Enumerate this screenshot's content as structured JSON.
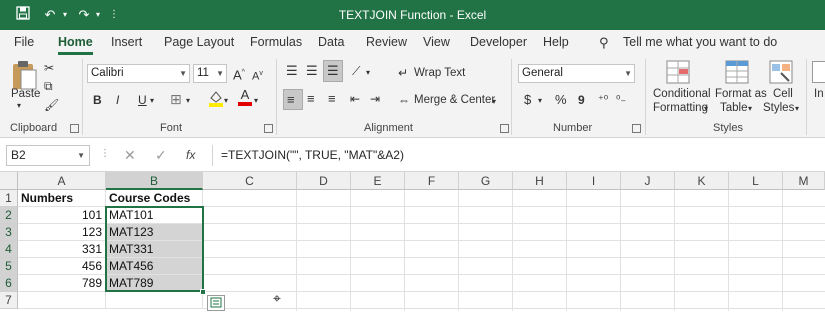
{
  "window": {
    "title": "TEXTJOIN Function  -  Excel"
  },
  "ribbon_tabs": [
    "File",
    "Home",
    "Insert",
    "Page Layout",
    "Formulas",
    "Data",
    "Review",
    "View",
    "Developer",
    "Help"
  ],
  "tell_me": "Tell me what you want to do",
  "clipboard": {
    "paste": "Paste",
    "label": "Clipboard"
  },
  "font": {
    "name": "Calibri",
    "size": "11",
    "label": "Font",
    "grow": "A",
    "shrink": "A",
    "bold": "B",
    "italic": "I",
    "underline": "U",
    "fontcolor": "A"
  },
  "alignment": {
    "wrap": "Wrap Text",
    "merge": "Merge & Center",
    "label": "Alignment"
  },
  "number": {
    "format": "General",
    "currency": "$",
    "percent": "%",
    "comma": "9",
    "label": "Number"
  },
  "styles": {
    "conditional_1": "Conditional",
    "conditional_2": "Formatting",
    "format_table_1": "Format as",
    "format_table_2": "Table",
    "cell_styles_1": "Cell",
    "cell_styles_2": "Styles",
    "label": "Styles",
    "insert": "In"
  },
  "formula_bar": {
    "name_box": "B2",
    "fx": "fx",
    "formula": "=TEXTJOIN(\"\", TRUE, \"MAT\"&A2)"
  },
  "columns": [
    "A",
    "B",
    "C",
    "D",
    "E",
    "F",
    "G",
    "H",
    "I",
    "J",
    "K",
    "L",
    "M"
  ],
  "rows": [
    "1",
    "2",
    "3",
    "4",
    "5",
    "6",
    "7"
  ],
  "sheet": {
    "A1": "Numbers",
    "B1": "Course Codes",
    "A2": "101",
    "B2": "MAT101",
    "A3": "123",
    "B3": "MAT123",
    "A4": "331",
    "B4": "MAT331",
    "A5": "456",
    "B5": "MAT456",
    "A6": "789",
    "B6": "MAT789"
  },
  "colors": {
    "accent": "#217346",
    "selection": "#d4d4d4"
  }
}
